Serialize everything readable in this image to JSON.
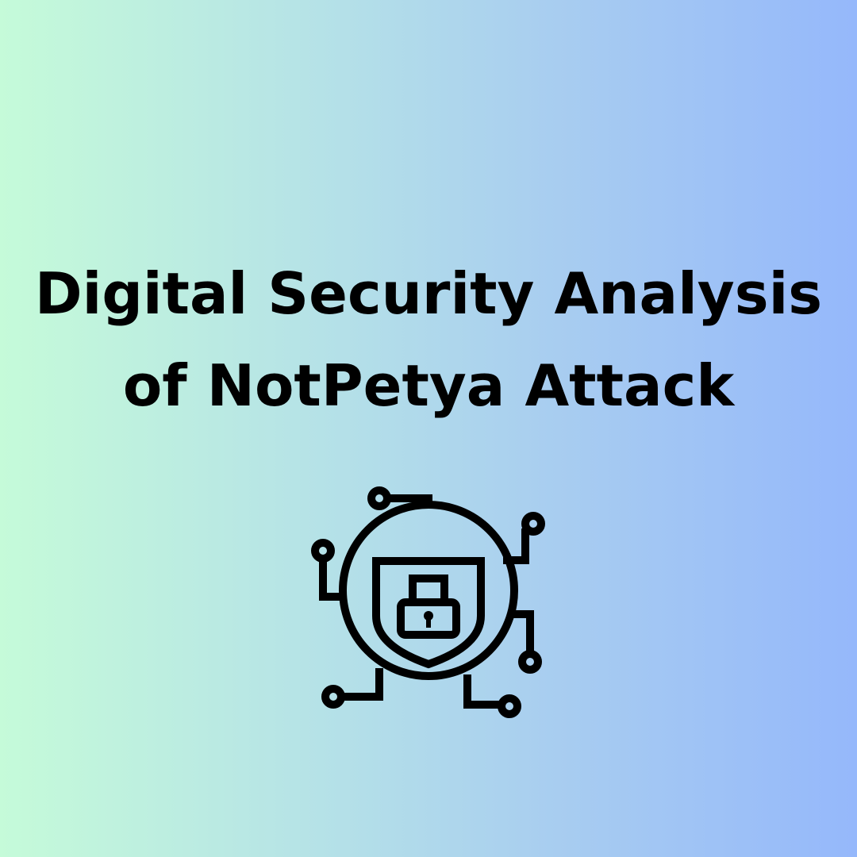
{
  "title": {
    "line1": "Digital Security Analysis",
    "line2": "of NotPetya Attack"
  },
  "icon": {
    "name": "cyber-security-shield-lock-circuit-icon",
    "stroke_color": "#000000"
  },
  "background": {
    "gradient_start": "#c5fbd9",
    "gradient_end": "#95b8fb"
  }
}
